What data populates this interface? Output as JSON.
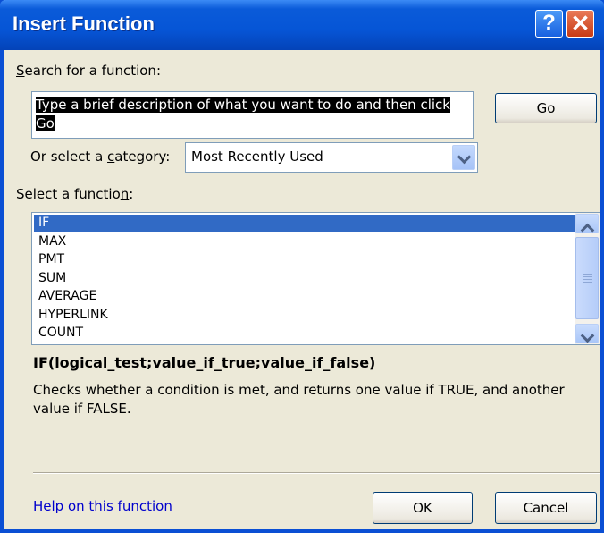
{
  "window": {
    "title": "Insert Function"
  },
  "search": {
    "label": "Search for a function:",
    "value": "Type a brief description of what you want to do and then click Go",
    "go_label": "Go"
  },
  "category": {
    "label": "Or select a category:",
    "selected": "Most Recently Used"
  },
  "functions": {
    "label": "Select a function:",
    "items": [
      "IF",
      "MAX",
      "PMT",
      "SUM",
      "AVERAGE",
      "HYPERLINK",
      "COUNT"
    ],
    "selected": "IF"
  },
  "details": {
    "syntax": "IF(logical_test;value_if_true;value_if_false)",
    "description": "Checks whether a condition is met, and returns one value if TRUE, and another value if FALSE."
  },
  "footer": {
    "help_link": "Help on this function",
    "ok_label": "OK",
    "cancel_label": "Cancel"
  },
  "colors": {
    "title_bar": "#0655d6",
    "selection": "#316ac5",
    "link": "#0000cc",
    "dialog_bg": "#ece9d8"
  }
}
